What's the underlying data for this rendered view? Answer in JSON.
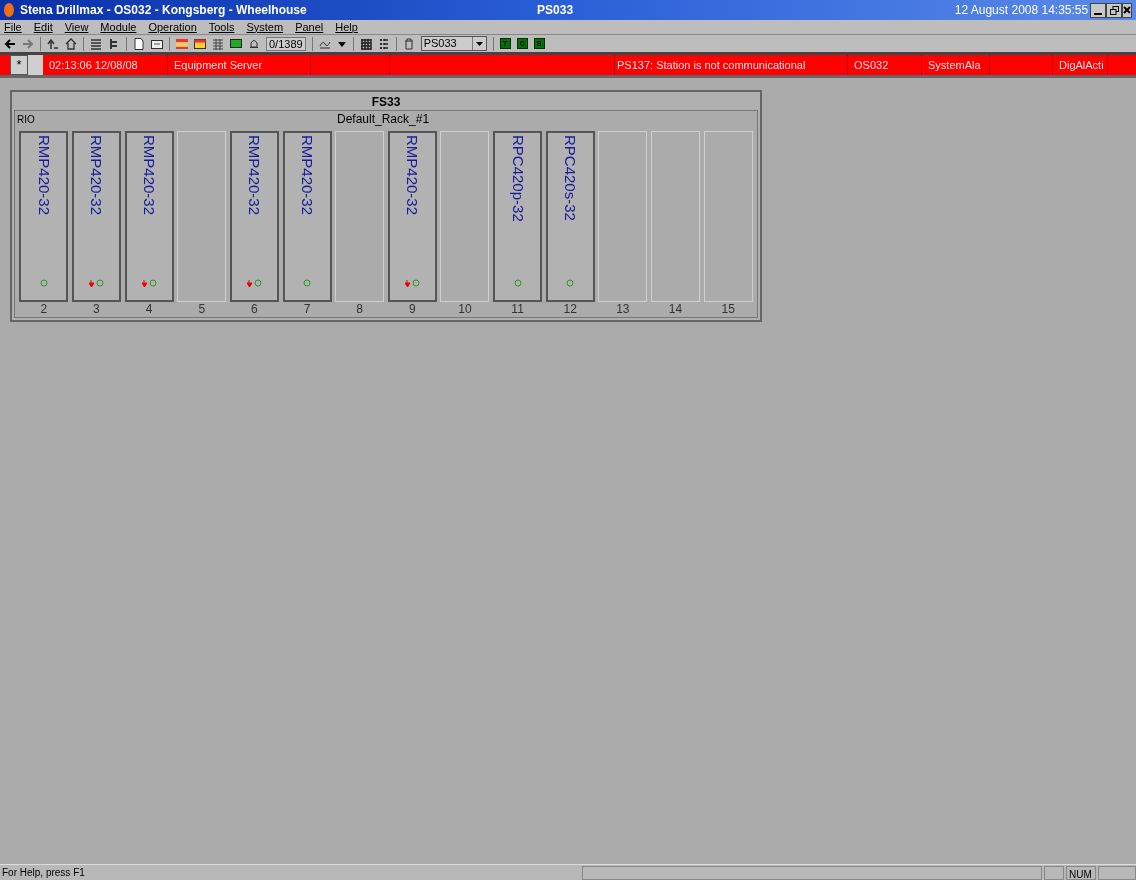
{
  "window": {
    "title": "Stena Drillmax - OS032 - Kongsberg - Wheelhouse",
    "station": "PS033",
    "datetime": "12 August 2008 14:35:55"
  },
  "menu": [
    "File",
    "Edit",
    "View",
    "Module",
    "Operation",
    "Tools",
    "System",
    "Panel",
    "Help"
  ],
  "toolbar": {
    "counter": "0/1389",
    "station_select": "PS033",
    "mode_buttons": [
      "T",
      "C",
      "S"
    ]
  },
  "alarm_bar": {
    "button": "*",
    "cells": [
      "02:13:06 12/08/08",
      "Equipment Server",
      "",
      "",
      "PS137:  Station is not communicational",
      "OS032",
      "SystemAla",
      "",
      "DigAlActi"
    ]
  },
  "rack": {
    "title": "FS33",
    "label": "RIO",
    "name": "Default_Rack_#1",
    "slots": [
      {
        "number": "2",
        "kind": "module",
        "module": "RMP420-32",
        "alarm": false
      },
      {
        "number": "3",
        "kind": "module",
        "module": "RMP420-32",
        "alarm": true
      },
      {
        "number": "4",
        "kind": "module",
        "module": "RMP420-32",
        "alarm": true
      },
      {
        "number": "5",
        "kind": "empty"
      },
      {
        "number": "6",
        "kind": "module",
        "module": "RMP420-32",
        "alarm": true
      },
      {
        "number": "7",
        "kind": "module",
        "module": "RMP420-32",
        "alarm": false
      },
      {
        "number": "8",
        "kind": "empty"
      },
      {
        "number": "9",
        "kind": "module",
        "module": "RMP420-32",
        "alarm": true
      },
      {
        "number": "10",
        "kind": "empty"
      },
      {
        "number": "11",
        "kind": "module",
        "module": "RPC420p-32",
        "alarm": false
      },
      {
        "number": "12",
        "kind": "module",
        "module": "RPC420s-32",
        "alarm": false
      },
      {
        "number": "13",
        "kind": "empty"
      },
      {
        "number": "14",
        "kind": "empty"
      },
      {
        "number": "15",
        "kind": "empty"
      }
    ]
  },
  "status_bar": {
    "help": "For Help, press F1",
    "num": "NUM"
  }
}
